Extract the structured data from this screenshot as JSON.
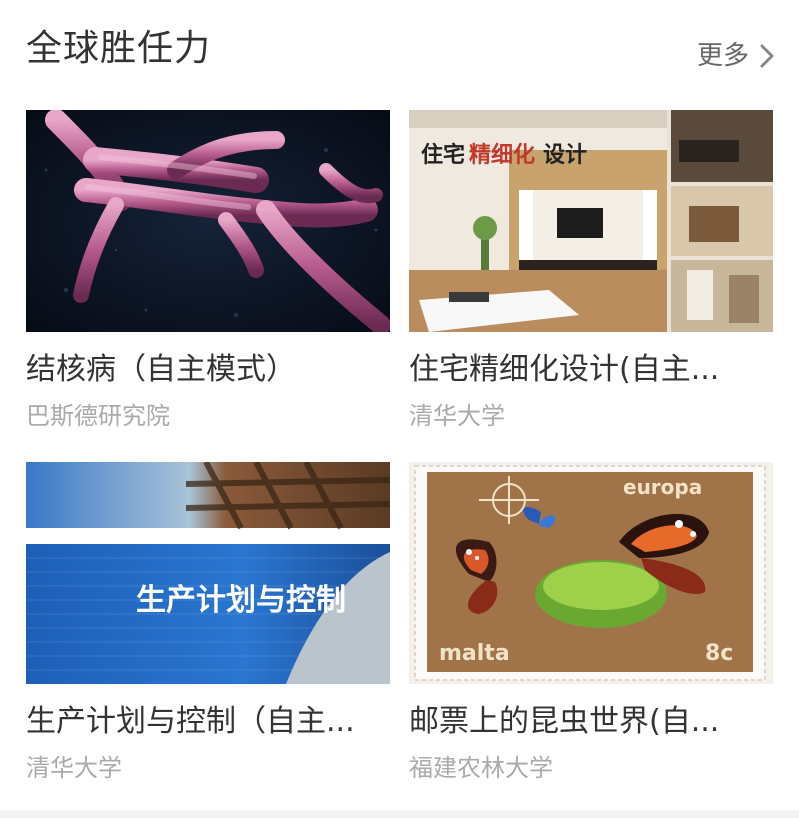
{
  "section": {
    "title": "全球胜任力",
    "more_label": "更多"
  },
  "courses": [
    {
      "title": "结核病（自主模式）",
      "institution": "巴斯德研究院",
      "thumb_icon": "bacteria-micrograph",
      "thumb_text": ""
    },
    {
      "title": "住宅精细化设计(自主...",
      "institution": "清华大学",
      "thumb_icon": "interior-design-photo",
      "thumb_text_a": "住宅",
      "thumb_text_b": "精细化",
      "thumb_text_c": "设计"
    },
    {
      "title": "生产计划与控制（自主...",
      "institution": "清华大学",
      "thumb_icon": "production-banner",
      "thumb_text": "生产计划与控制"
    },
    {
      "title": "邮票上的昆虫世界(自...",
      "institution": "福建农林大学",
      "thumb_icon": "butterfly-stamp",
      "stamp_top": "europa",
      "stamp_country": "malta",
      "stamp_value": "8c"
    }
  ],
  "colors": {
    "title_text": "#333333",
    "subtitle_text": "#aaaaaa",
    "more_text": "#666666"
  }
}
